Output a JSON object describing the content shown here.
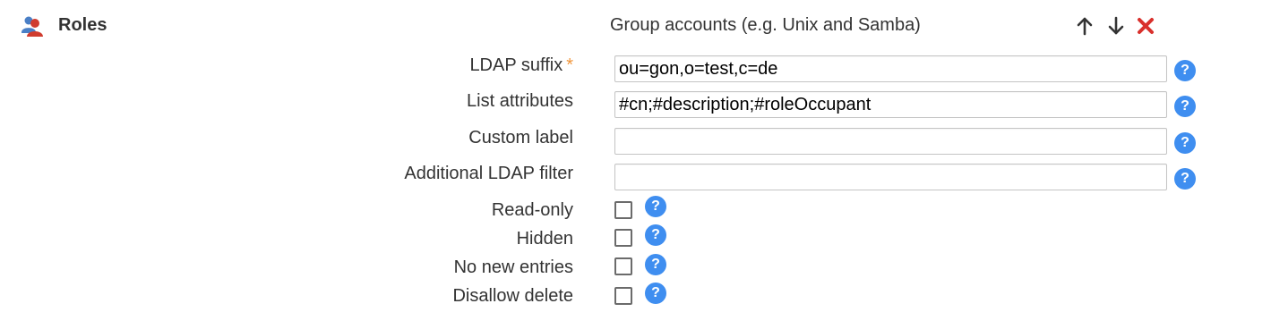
{
  "header": {
    "module_title": "Roles",
    "group_title": "Group accounts (e.g. Unix and Samba)",
    "controls": {
      "move_up_icon": "arrow-up-icon",
      "move_down_icon": "arrow-down-icon",
      "remove_icon": "close-icon",
      "remove_color": "#d9302c"
    }
  },
  "fields": {
    "ldap_suffix": {
      "label": "LDAP suffix",
      "required_mark": "*",
      "value": "ou=gon,o=test,c=de"
    },
    "list_attributes": {
      "label": "List attributes",
      "value": "#cn;#description;#roleOccupant"
    },
    "custom_label": {
      "label": "Custom label",
      "value": ""
    },
    "additional_filter": {
      "label": "Additional LDAP filter",
      "value": ""
    }
  },
  "checkboxes": {
    "read_only": {
      "label": "Read-only",
      "checked": false
    },
    "hidden": {
      "label": "Hidden",
      "checked": false
    },
    "no_new_entries": {
      "label": "No new entries",
      "checked": false
    },
    "disallow_delete": {
      "label": "Disallow delete",
      "checked": false
    }
  },
  "help": {
    "glyph": "?",
    "color": "#3f8ef0"
  },
  "colors": {
    "required_star": "#f0953a",
    "text": "#333333"
  }
}
